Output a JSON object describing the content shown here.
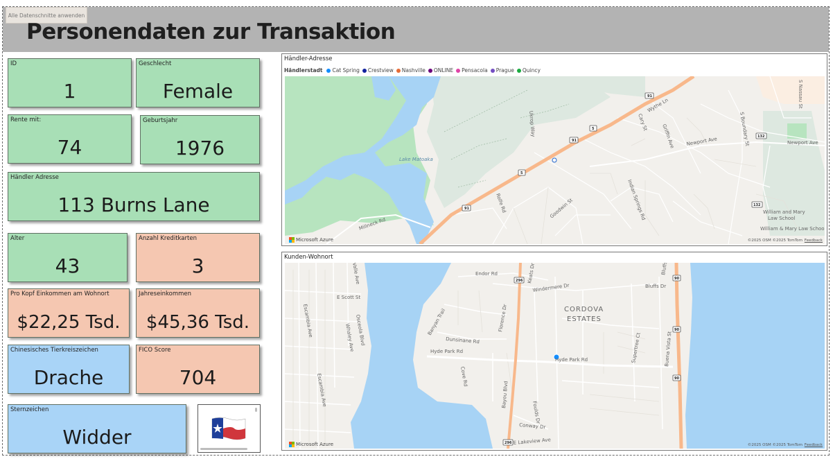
{
  "page": {
    "title": "Personendaten zur Transaktion",
    "slicer_button": "Alle Datenschnitte anwenden"
  },
  "cards": {
    "id": {
      "label": "ID",
      "value": "1"
    },
    "gender": {
      "label": "Geschlecht",
      "value": "Female"
    },
    "retire": {
      "label": "Rente mit:",
      "value": "74"
    },
    "birth_year": {
      "label": "Geburtsjahr",
      "value": "1976"
    },
    "dealer_address": {
      "label": "Händler Adresse",
      "value": "113 Burns Lane"
    },
    "age": {
      "label": "Alter",
      "value": "43"
    },
    "credit_cards": {
      "label": "Anzahl Kreditkarten",
      "value": "3"
    },
    "per_capita_income": {
      "label": "Pro Kopf Einkommen am Wohnort",
      "value": "$22,25 Tsd."
    },
    "yearly_income": {
      "label": "Jahreseinkommen",
      "value": "$45,36 Tsd."
    },
    "zodiac_cn": {
      "label": "Chinesisches Tierkreiszeichen",
      "value": "Drache"
    },
    "fico": {
      "label": "FICO Score",
      "value": "704"
    },
    "star_sign": {
      "label": "Sternzeichen",
      "value": "Widder"
    }
  },
  "flag_image": {
    "icon": "texas-flag-icon"
  },
  "map_dealer": {
    "title": "Händler-Adresse",
    "legend_title": "Händlerstadt",
    "legend": [
      {
        "label": "Cat Spring",
        "color": "#118DFF"
      },
      {
        "label": "Crestview",
        "color": "#12239E"
      },
      {
        "label": "Nashville",
        "color": "#E66C37"
      },
      {
        "label": "ONLINE",
        "color": "#6B007B"
      },
      {
        "label": "Pensacola",
        "color": "#E044A7"
      },
      {
        "label": "Prague",
        "color": "#744EC2"
      },
      {
        "label": "Quincy",
        "color": "#1AAB40"
      }
    ],
    "labels": {
      "lake": "Lake Matoaka",
      "millneck": "Millneck Rd",
      "rolfe": "Rolfe Rd",
      "goodwin": "Goodwin St",
      "indian": "Indian Springs Rd",
      "newport": "Newport Ave",
      "newport2": "Newport Ave",
      "boundary": "S Boundary St",
      "nassau": "S Nassau St",
      "wythe": "Wythe Ln",
      "cary": "Cary St",
      "griffin": "Griffin Ave",
      "ukrop": "Ukrop Way",
      "wm1": "William and Mary",
      "wm2": "Law School",
      "wm3": "William & Mary Law School",
      "r91a": "91",
      "r91b": "91",
      "r91c": "91",
      "r5a": "5",
      "r5b": "5",
      "r132a": "132",
      "r132b": "132"
    },
    "ms_azure": "Microsoft Azure",
    "attribution": "©2025 OSM  ©2025 TomTom",
    "feedback": "Feedback"
  },
  "map_customer": {
    "title": "Kunden-Wohnort",
    "labels": {
      "cordova1": "CORDOVA",
      "cordova2": "ESTATES",
      "hyde1": "Hyde Park Rd",
      "hyde2": "Hyde Park Rd",
      "endor": "Endor Rd",
      "windermere": "Windermere Dr",
      "bluffs": "Bluffs Dr",
      "bluffs2": "Bluffs",
      "dunsinane": "Dunsinane Rd",
      "bayou": "Bayou Blvd",
      "lakeview": "E Lakeview Ave",
      "conway": "Conway Dr",
      "escambia": "Escambia Ave",
      "escambia2": "Escambia Ave",
      "escott": "E Scott St",
      "whaley": "Whaley Ave",
      "osceola": "Osceola Blvd",
      "valle": "Valle Ave",
      "florence": "Florence Dr",
      "cove": "Cove Rd",
      "foulds": "Foulds Dr",
      "keats": "Keats Dr",
      "buena": "Buena Vista St",
      "supertree": "Supertree Ct",
      "banyan": "Banyan Trail",
      "r296a": "296",
      "r296b": "296",
      "r90a": "90",
      "r90b": "90",
      "r90c": "90"
    },
    "ms_azure": "Microsoft Azure",
    "attribution": "©2025 OSM  ©2025 TomTom",
    "feedback": "Feedback"
  },
  "colors": {
    "header_bg": "#b3b3b3",
    "card_green": "#a8dfb6",
    "card_peach": "#f5c7b1",
    "card_blue": "#a9d4f7",
    "water": "#a7d3f5",
    "park": "#b7e4bf",
    "highway": "#f8b88b"
  }
}
